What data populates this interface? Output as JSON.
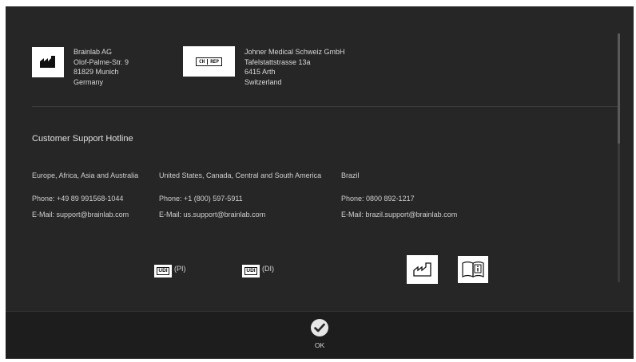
{
  "manufacturer": {
    "icon": "manufacturer-icon",
    "lines": [
      "Brainlab AG",
      "Olof-Palme-Str. 9",
      "81829 Munich",
      "Germany"
    ]
  },
  "ch_rep": {
    "icon": "ch-rep-icon",
    "badge_left": "CH",
    "badge_right": "REP",
    "lines": [
      "Johner Medical Schweiz GmbH",
      "Tafelstattstrasse 13a",
      "6415 Arth",
      "Switzerland"
    ]
  },
  "support": {
    "heading": "Customer Support Hotline",
    "regions": [
      {
        "name": "Europe, Africa, Asia and Australia",
        "phone": "Phone: +49 89 991568-1044",
        "email": "E-Mail: support@brainlab.com"
      },
      {
        "name": "United States, Canada, Central and South America",
        "phone": "Phone: +1 (800) 597-5911",
        "email": "E-Mail: us.support@brainlab.com"
      },
      {
        "name": "Brazil",
        "phone": "Phone: 0800 892-1217",
        "email": "E-Mail: brazil.support@brainlab.com"
      }
    ]
  },
  "udi": [
    {
      "badge": "UDI",
      "label": "(PI)"
    },
    {
      "badge": "UDI",
      "label": "(DI)"
    }
  ],
  "symbols": {
    "date_of_manufacture_icon": "date-of-manufacture-icon",
    "instructions_icon": "consult-instructions-icon"
  },
  "footer": {
    "ok_label": "OK",
    "ok_icon": "checkmark-icon"
  }
}
